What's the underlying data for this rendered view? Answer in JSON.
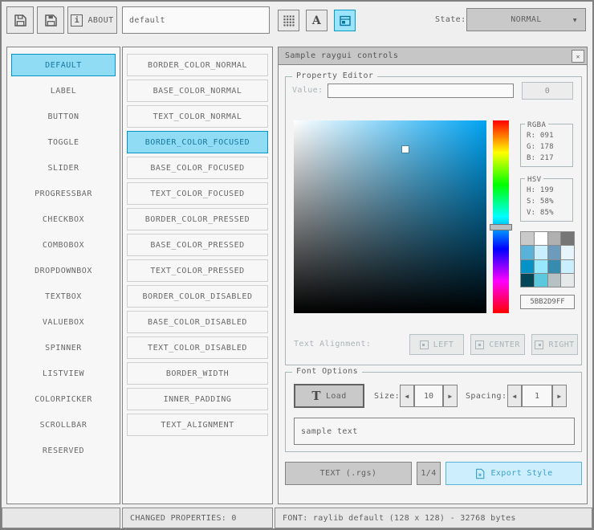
{
  "colors": {
    "accent": "#0492c7",
    "selection_bg": "#91dcf5",
    "focused_border": "#5bb2d9",
    "focused_bg": "#cdeffd",
    "border_gray": "#838383"
  },
  "icons": {
    "close": "✕",
    "dropdown_arrow": "▼",
    "spinner_left": "◀",
    "spinner_right": "▶",
    "info": "i",
    "font_letter": "A",
    "load_t": "T"
  },
  "toolbar": {
    "about_label": "ABOUT",
    "style_name": "default",
    "state_label": "State:",
    "state_value": "NORMAL"
  },
  "controls_list": [
    {
      "label": "DEFAULT",
      "selected": true
    },
    {
      "label": "LABEL"
    },
    {
      "label": "BUTTON"
    },
    {
      "label": "TOGGLE"
    },
    {
      "label": "SLIDER"
    },
    {
      "label": "PROGRESSBAR"
    },
    {
      "label": "CHECKBOX"
    },
    {
      "label": "COMBOBOX"
    },
    {
      "label": "DROPDOWNBOX"
    },
    {
      "label": "TEXTBOX"
    },
    {
      "label": "VALUEBOX"
    },
    {
      "label": "SPINNER"
    },
    {
      "label": "LISTVIEW"
    },
    {
      "label": "COLORPICKER"
    },
    {
      "label": "SCROLLBAR"
    },
    {
      "label": "RESERVED"
    }
  ],
  "properties_list": [
    {
      "label": "BORDER_COLOR_NORMAL"
    },
    {
      "label": "BASE_COLOR_NORMAL"
    },
    {
      "label": "TEXT_COLOR_NORMAL"
    },
    {
      "label": "BORDER_COLOR_FOCUSED",
      "selected": true
    },
    {
      "label": "BASE_COLOR_FOCUSED"
    },
    {
      "label": "TEXT_COLOR_FOCUSED"
    },
    {
      "label": "BORDER_COLOR_PRESSED"
    },
    {
      "label": "BASE_COLOR_PRESSED"
    },
    {
      "label": "TEXT_COLOR_PRESSED"
    },
    {
      "label": "BORDER_COLOR_DISABLED"
    },
    {
      "label": "BASE_COLOR_DISABLED"
    },
    {
      "label": "TEXT_COLOR_DISABLED"
    },
    {
      "label": "BORDER_WIDTH"
    },
    {
      "label": "INNER_PADDING"
    },
    {
      "label": "TEXT_ALIGNMENT"
    }
  ],
  "sample_window": {
    "title": "Sample raygui controls",
    "property_editor": {
      "title": "Property Editor",
      "value_label": "Value:",
      "value_text": "",
      "aux_button": "0",
      "rgba": {
        "title": "RGBA",
        "r": "R: 091",
        "g": "G: 178",
        "b": "B: 217"
      },
      "hsv": {
        "title": "HSV",
        "h": "H: 199",
        "s": "S: 58%",
        "v": "V: 85%"
      },
      "hex_value": "5BB2D9FF",
      "text_alignment_label": "Text Alignment:",
      "align_left": "LEFT",
      "align_center": "CENTER",
      "align_right": "RIGHT"
    },
    "font_options": {
      "title": "Font Options",
      "load_label": "Load",
      "size_label": "Size:",
      "size_value": "10",
      "spacing_label": "Spacing:",
      "spacing_value": "1",
      "sample_text": "sample text"
    },
    "export_bar": {
      "format_button": "TEXT (.rgs)",
      "page_button": "1/4",
      "export_button": "Export Style"
    }
  },
  "palette": [
    {
      "color": "#c9c9c9"
    },
    {
      "color": "#ffffff"
    },
    {
      "color": "#b0b0b0"
    },
    {
      "color": "#767676"
    },
    {
      "color": "#5bb2d9"
    },
    {
      "color": "#c9effe"
    },
    {
      "color": "#6c9bbc"
    },
    {
      "color": "#e6f5fc"
    },
    {
      "color": "#0492c7"
    },
    {
      "color": "#97e8ff"
    },
    {
      "color": "#368baf"
    },
    {
      "color": "#c9effe"
    },
    {
      "color": "#024658"
    },
    {
      "color": "#5bc8de"
    },
    {
      "color": "#b5c1c2"
    },
    {
      "color": "#e6e9e9"
    }
  ],
  "statusbar": {
    "changed_properties": "CHANGED PROPERTIES: 0",
    "font_info": "FONT: raylib default (128 x 128) - 32768 bytes"
  }
}
